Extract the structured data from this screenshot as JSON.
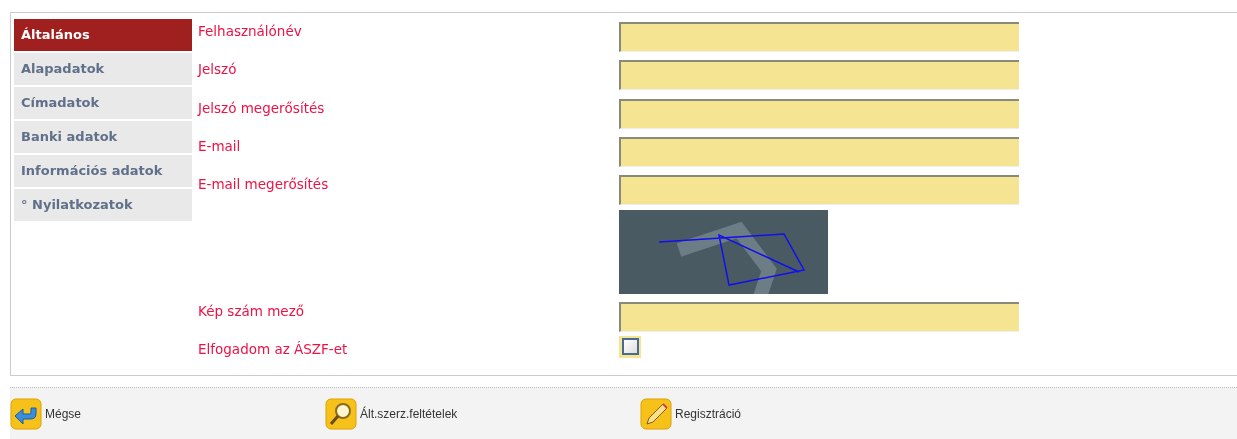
{
  "sidebar": {
    "items": [
      {
        "label": "Általános",
        "selected": true
      },
      {
        "label": "Alapadatok",
        "selected": false
      },
      {
        "label": "Címadatok",
        "selected": false
      },
      {
        "label": "Banki adatok",
        "selected": false
      },
      {
        "label": "Információs adatok",
        "selected": false
      },
      {
        "label": "° Nyilatkozatok",
        "selected": false
      }
    ]
  },
  "form": {
    "rows": [
      {
        "kind": "text",
        "label": "Felhasználónév"
      },
      {
        "kind": "text",
        "label": "Jelszó"
      },
      {
        "kind": "text",
        "label": "Jelszó megerősítés"
      },
      {
        "kind": "text",
        "label": "E-mail"
      },
      {
        "kind": "text",
        "label": "E-mail megerősítés"
      },
      {
        "kind": "captcha"
      },
      {
        "kind": "text",
        "label": "Kép szám mező"
      },
      {
        "kind": "checkbox",
        "label": "Elfogadom az ÁSZF-et",
        "checked": false
      }
    ]
  },
  "toolbar": {
    "buttons": [
      {
        "kind": "cancel",
        "label": "Mégse"
      },
      {
        "kind": "view",
        "label": "Ált.szerz.feltételek"
      },
      {
        "kind": "edit",
        "label": "Regisztráció"
      }
    ]
  }
}
